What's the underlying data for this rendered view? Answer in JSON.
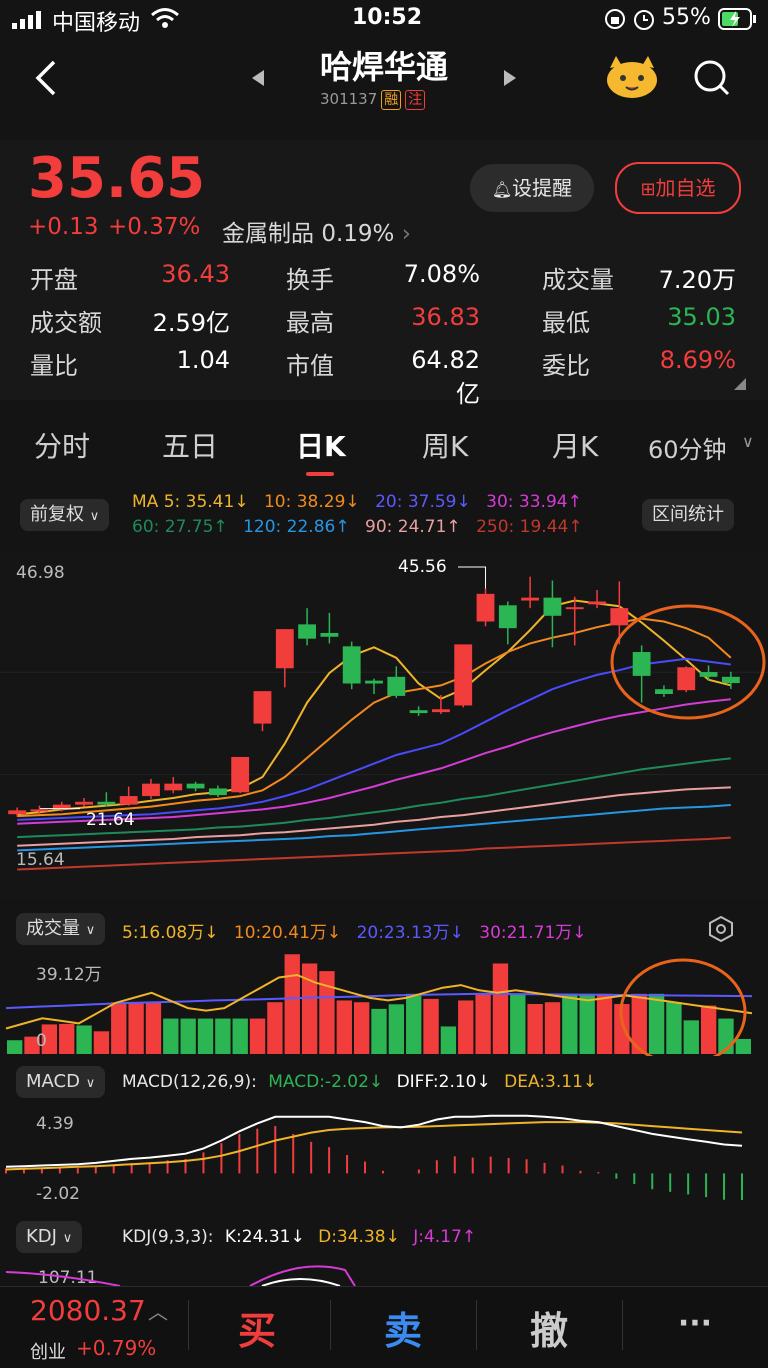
{
  "status_bar": {
    "carrier": "中国移动",
    "time": "10:52",
    "battery": "55%"
  },
  "nav": {
    "title": "哈焊华通",
    "code": "301137",
    "tag1": "融",
    "tag2": "注"
  },
  "quote": {
    "price": "35.65",
    "change": "+0.13",
    "change_pct": "+0.37%",
    "sector": "金属制品",
    "sector_pct": "0.19%",
    "alert_label": "设提醒",
    "watch_label": "加自选",
    "stats": [
      {
        "label": "开盘",
        "value": "36.43",
        "color": "red"
      },
      {
        "label": "换手",
        "value": "7.08%",
        "color": "white"
      },
      {
        "label": "成交量",
        "value": "7.20万",
        "color": "white"
      },
      {
        "label": "成交额",
        "value": "2.59亿",
        "color": "white"
      },
      {
        "label": "最高",
        "value": "36.83",
        "color": "red"
      },
      {
        "label": "最低",
        "value": "35.03",
        "color": "green"
      },
      {
        "label": "量比",
        "value": "1.04",
        "color": "white"
      },
      {
        "label": "市值",
        "value": "64.82亿",
        "color": "white"
      },
      {
        "label": "委比",
        "value": "8.69%",
        "color": "red"
      }
    ]
  },
  "tabs": [
    "分时",
    "五日",
    "日K",
    "周K",
    "月K",
    "60分钟"
  ],
  "kline": {
    "adjust_label": "前复权",
    "range_label": "区间统计",
    "ma_row1": [
      {
        "text": "MA 5: 35.41↓",
        "color": "#f0b429"
      },
      {
        "text": "10: 38.29↓",
        "color": "#f28a1e"
      },
      {
        "text": "20: 37.59↓",
        "color": "#4a4aff"
      },
      {
        "text": "30: 33.94↑",
        "color": "#d53bd5"
      }
    ],
    "ma_row2": [
      {
        "text": "60: 27.75↑",
        "color": "#1e8a5a"
      },
      {
        "text": "120: 22.86↑",
        "color": "#2596e6"
      },
      {
        "text": "90: 24.71↑",
        "color": "#e8a0a0"
      },
      {
        "text": "250: 19.44↑",
        "color": "#c0392b"
      }
    ],
    "top_label": "46.98",
    "bottom_label": "15.64",
    "peak_label": "45.56",
    "low_label": "21.64"
  },
  "volume": {
    "label": "成交量",
    "ma_items": [
      {
        "text": "5:16.08万↓",
        "color": "#f0b429"
      },
      {
        "text": "10:20.41万↓",
        "color": "#f28a1e"
      },
      {
        "text": "20:23.13万↓",
        "color": "#4a4aff"
      },
      {
        "text": "30:21.71万↓",
        "color": "#d53bd5"
      }
    ],
    "top_label": "39.12万",
    "zero_label": "0"
  },
  "macd": {
    "label": "MACD",
    "params": "MACD(12,26,9):",
    "macd_val": "MACD:-2.02↓",
    "diff_val": "DIFF:2.10↓",
    "dea_val": "DEA:3.11↓",
    "top_label": "4.39",
    "bottom_label": "-2.02"
  },
  "kdj": {
    "label": "KDJ",
    "params": "KDJ(9,3,3):",
    "k_val": "K:24.31↓",
    "d_val": "D:34.38↓",
    "j_val": "J:4.17↑",
    "top_label": "107.11"
  },
  "bottom": {
    "index_value": "2080.37",
    "index_name": "创业",
    "index_pct": "+0.79%",
    "buy": "买",
    "sell": "卖",
    "cancel": "撤",
    "more": "···"
  },
  "chart_data": {
    "type": "candlestick",
    "ohlc": [
      {
        "o": 21.9,
        "c": 22.3,
        "h": 22.6,
        "l": 21.64
      },
      {
        "o": 22.2,
        "c": 22.4,
        "h": 22.8,
        "l": 21.9
      },
      {
        "o": 22.4,
        "c": 22.9,
        "h": 23.2,
        "l": 22.2
      },
      {
        "o": 22.9,
        "c": 23.2,
        "h": 23.6,
        "l": 22.7
      },
      {
        "o": 23.2,
        "c": 22.9,
        "h": 24.2,
        "l": 22.7
      },
      {
        "o": 22.9,
        "c": 23.8,
        "h": 24.8,
        "l": 22.8
      },
      {
        "o": 23.8,
        "c": 25.1,
        "h": 25.6,
        "l": 23.5
      },
      {
        "o": 24.4,
        "c": 25.1,
        "h": 25.8,
        "l": 24.1
      },
      {
        "o": 25.1,
        "c": 24.6,
        "h": 25.3,
        "l": 24.3
      },
      {
        "o": 24.6,
        "c": 23.9,
        "h": 24.9,
        "l": 23.7
      },
      {
        "o": 24.2,
        "c": 27.9,
        "h": 27.9,
        "l": 24.1
      },
      {
        "o": 31.4,
        "c": 34.8,
        "h": 34.8,
        "l": 30.6
      },
      {
        "o": 37.2,
        "c": 41.3,
        "h": 41.3,
        "l": 35.2
      },
      {
        "o": 41.8,
        "c": 40.3,
        "h": 43.5,
        "l": 39.6
      },
      {
        "o": 40.9,
        "c": 40.5,
        "h": 43.0,
        "l": 39.8
      },
      {
        "o": 39.5,
        "c": 35.6,
        "h": 40.0,
        "l": 35.0
      },
      {
        "o": 35.9,
        "c": 35.6,
        "h": 36.1,
        "l": 34.5
      },
      {
        "o": 36.3,
        "c": 34.3,
        "h": 37.4,
        "l": 34.1
      },
      {
        "o": 32.8,
        "c": 32.5,
        "h": 33.2,
        "l": 32.2
      },
      {
        "o": 32.6,
        "c": 32.9,
        "h": 34.4,
        "l": 32.4
      },
      {
        "o": 33.3,
        "c": 39.7,
        "h": 39.7,
        "l": 33.1
      },
      {
        "o": 42.1,
        "c": 45.0,
        "h": 45.56,
        "l": 41.6
      },
      {
        "o": 43.8,
        "c": 41.4,
        "h": 44.2,
        "l": 39.7
      },
      {
        "o": 44.3,
        "c": 44.6,
        "h": 46.8,
        "l": 43.5
      },
      {
        "o": 44.6,
        "c": 42.7,
        "h": 46.4,
        "l": 39.4
      },
      {
        "o": 43.4,
        "c": 43.6,
        "h": 44.7,
        "l": 39.6
      },
      {
        "o": 43.9,
        "c": 44.2,
        "h": 45.4,
        "l": 43.5
      },
      {
        "o": 41.7,
        "c": 43.5,
        "h": 46.3,
        "l": 39.7
      },
      {
        "o": 38.9,
        "c": 36.4,
        "h": 39.6,
        "l": 33.6
      },
      {
        "o": 35.0,
        "c": 34.5,
        "h": 35.4,
        "l": 34.2
      },
      {
        "o": 34.9,
        "c": 37.3,
        "h": 37.4,
        "l": 34.7
      },
      {
        "o": 36.8,
        "c": 36.3,
        "h": 37.5,
        "l": 35.9
      },
      {
        "o": 36.3,
        "c": 35.65,
        "h": 36.83,
        "l": 35.03
      }
    ],
    "ma": [
      {
        "name": "MA5",
        "color": "#f0b429",
        "values": [
          21.9,
          22.1,
          22.4,
          22.6,
          22.8,
          23.0,
          23.3,
          23.6,
          24.0,
          24.2,
          24.6,
          25.8,
          29.3,
          33.6,
          36.7,
          38.5,
          39.4,
          38.3,
          35.6,
          34.0,
          35.0,
          37.0,
          38.9,
          41.2,
          43.7,
          44.3,
          44.0,
          43.7,
          42.0,
          40.1,
          38.1,
          36.0,
          35.41
        ]
      },
      {
        "name": "MA10",
        "color": "#f28a1e",
        "values": [
          21.7,
          21.8,
          21.9,
          22.1,
          22.3,
          22.5,
          22.7,
          23.0,
          23.3,
          23.5,
          23.8,
          24.4,
          25.8,
          27.8,
          29.8,
          31.8,
          33.6,
          34.6,
          35.0,
          35.4,
          36.3,
          37.7,
          38.9,
          39.8,
          40.4,
          40.9,
          41.5,
          42.0,
          42.4,
          42.1,
          41.4,
          40.4,
          38.29
        ]
      },
      {
        "name": "MA20",
        "color": "#4a4aff",
        "values": [
          21.3,
          21.4,
          21.5,
          21.6,
          21.7,
          21.8,
          21.9,
          22.1,
          22.3,
          22.5,
          22.8,
          23.2,
          23.8,
          24.5,
          25.4,
          26.3,
          27.2,
          28.1,
          28.7,
          29.3,
          30.4,
          31.6,
          32.8,
          33.9,
          35.0,
          35.8,
          36.5,
          37.0,
          37.6,
          37.9,
          38.2,
          37.9,
          37.59
        ]
      },
      {
        "name": "MA30",
        "color": "#d53bd5",
        "values": [
          20.9,
          21.0,
          21.1,
          21.2,
          21.3,
          21.4,
          21.5,
          21.6,
          21.8,
          22.0,
          22.2,
          22.4,
          22.7,
          23.1,
          23.6,
          24.2,
          24.8,
          25.5,
          26.1,
          26.7,
          27.5,
          28.3,
          29.0,
          29.8,
          30.5,
          31.1,
          31.7,
          32.2,
          32.6,
          33.0,
          33.4,
          33.7,
          33.94
        ]
      },
      {
        "name": "MA60",
        "color": "#1e8a5a",
        "values": [
          19.5,
          19.6,
          19.7,
          19.8,
          19.9,
          20.0,
          20.1,
          20.2,
          20.3,
          20.5,
          20.6,
          20.8,
          21.0,
          21.3,
          21.5,
          21.8,
          22.1,
          22.4,
          22.8,
          23.1,
          23.5,
          23.8,
          24.2,
          24.6,
          25.0,
          25.4,
          25.8,
          26.2,
          26.6,
          26.9,
          27.2,
          27.5,
          27.75
        ]
      },
      {
        "name": "MA90",
        "color": "#e8a0a0",
        "values": [
          18.6,
          18.7,
          18.8,
          18.9,
          19.0,
          19.1,
          19.2,
          19.3,
          19.5,
          19.6,
          19.7,
          19.9,
          20.0,
          20.2,
          20.4,
          20.6,
          20.8,
          21.1,
          21.3,
          21.6,
          21.8,
          22.1,
          22.4,
          22.7,
          23.0,
          23.3,
          23.6,
          23.9,
          24.1,
          24.3,
          24.5,
          24.6,
          24.71
        ]
      },
      {
        "name": "MA120",
        "color": "#2596e6",
        "values": [
          18.1,
          18.2,
          18.3,
          18.4,
          18.5,
          18.6,
          18.7,
          18.8,
          18.9,
          19.0,
          19.1,
          19.2,
          19.3,
          19.4,
          19.6,
          19.7,
          19.9,
          20.1,
          20.3,
          20.5,
          20.7,
          20.9,
          21.1,
          21.3,
          21.5,
          21.7,
          21.9,
          22.1,
          22.3,
          22.5,
          22.6,
          22.7,
          22.86
        ]
      },
      {
        "name": "MA250",
        "color": "#c0392b",
        "values": [
          16.1,
          16.2,
          16.3,
          16.4,
          16.5,
          16.6,
          16.7,
          16.8,
          16.9,
          17.0,
          17.1,
          17.2,
          17.3,
          17.4,
          17.5,
          17.6,
          17.7,
          17.8,
          17.9,
          18.0,
          18.1,
          18.3,
          18.4,
          18.5,
          18.6,
          18.7,
          18.8,
          18.9,
          19.0,
          19.1,
          19.2,
          19.3,
          19.44
        ]
      }
    ],
    "volume": [
      5.4,
      6.8,
      11.6,
      11.8,
      11.2,
      8.9,
      20.3,
      20.3,
      20.3,
      13.9,
      13.9,
      13.9,
      13.9,
      13.9,
      13.9,
      20.3,
      39.12,
      35.5,
      32.5,
      21.0,
      20.3,
      17.7,
      19.5,
      23.6,
      21.6,
      10.8,
      21.0,
      23.6,
      35.5,
      23.6,
      19.6,
      20.3,
      23.6,
      23.6,
      23.6,
      19.6,
      23.6,
      23.6,
      20.3,
      13.2,
      19.0,
      13.9,
      5.9
    ],
    "volume_up": [
      false,
      true,
      true,
      true,
      false,
      true,
      true,
      true,
      true,
      false,
      false,
      false,
      false,
      false,
      true,
      true,
      true,
      true,
      true,
      true,
      true,
      false,
      false,
      false,
      true,
      false,
      true,
      true,
      true,
      false,
      true,
      true,
      false,
      false,
      true,
      true,
      true,
      false,
      false,
      false,
      true,
      false,
      false
    ],
    "macd_diff": [
      0.5,
      0.55,
      0.6,
      0.65,
      0.7,
      0.8,
      0.95,
      1.1,
      1.2,
      1.35,
      1.5,
      1.9,
      2.5,
      3.2,
      3.8,
      4.3,
      4.3,
      4.3,
      4.3,
      4.1,
      3.9,
      3.6,
      3.5,
      3.7,
      4.1,
      4.3,
      4.3,
      4.39,
      4.39,
      4.39,
      4.3,
      4.2,
      4.0,
      3.9,
      3.6,
      3.3,
      3.0,
      2.8,
      2.6,
      2.4,
      2.2,
      2.1
    ],
    "macd_dea": [
      0.3,
      0.35,
      0.4,
      0.45,
      0.5,
      0.55,
      0.62,
      0.7,
      0.78,
      0.85,
      0.95,
      1.1,
      1.35,
      1.7,
      2.1,
      2.5,
      2.8,
      3.1,
      3.3,
      3.4,
      3.45,
      3.5,
      3.52,
      3.55,
      3.6,
      3.65,
      3.7,
      3.75,
      3.8,
      3.85,
      3.9,
      3.9,
      3.9,
      3.85,
      3.8,
      3.7,
      3.6,
      3.5,
      3.4,
      3.3,
      3.2,
      3.11
    ]
  }
}
